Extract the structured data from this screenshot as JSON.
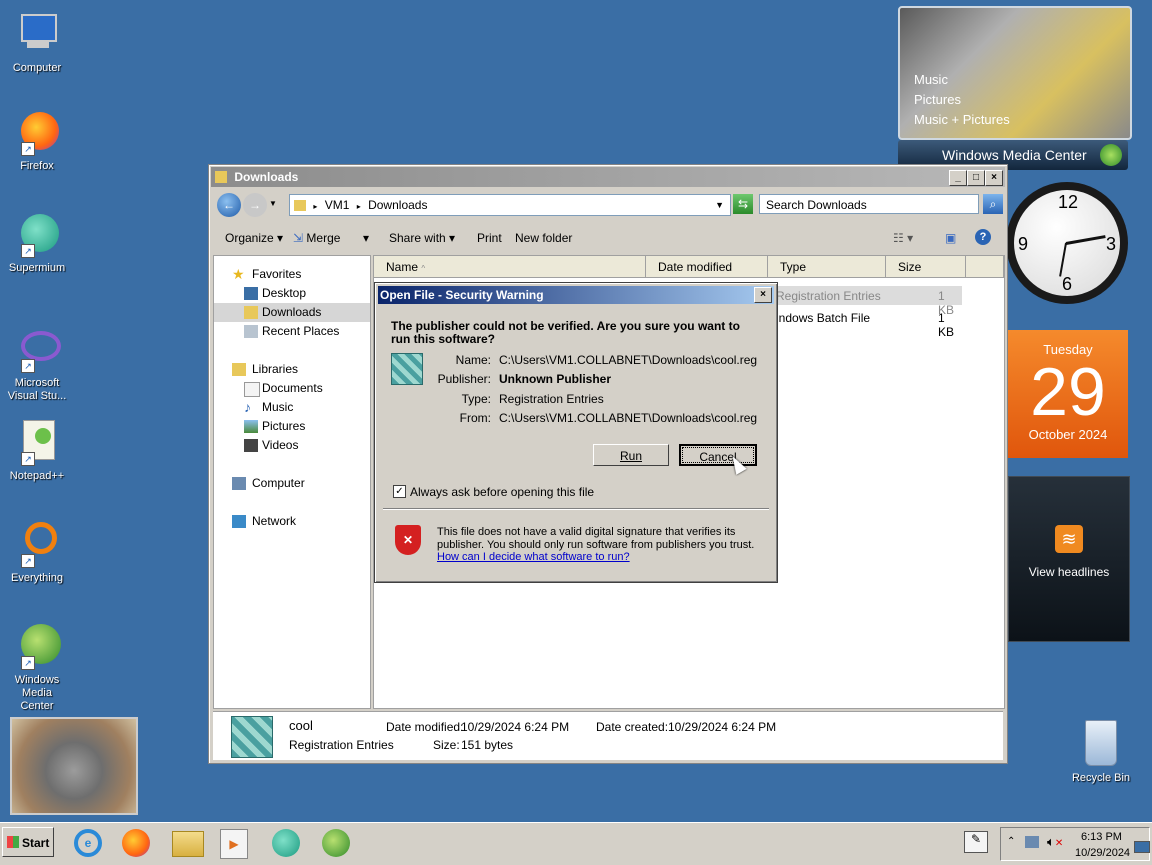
{
  "desktop": {
    "icons": [
      {
        "label": "Computer",
        "icon": "computer-icon"
      },
      {
        "label": "Firefox",
        "icon": "firefox-icon"
      },
      {
        "label": "Supermium",
        "icon": "supermium-icon"
      },
      {
        "label": "Microsoft Visual Stu...",
        "icon": "visual-studio-icon"
      },
      {
        "label": "Notepad++",
        "icon": "notepad-plus-plus-icon"
      },
      {
        "label": "Everything",
        "icon": "everything-icon"
      },
      {
        "label": "Windows Media Center",
        "icon": "windows-media-center-icon"
      }
    ],
    "recycle_bin": "Recycle Bin"
  },
  "gadgets": {
    "media_center": {
      "items": [
        "Music",
        "Pictures",
        "Music + Pictures"
      ],
      "brand": "Windows Media Center"
    },
    "calendar": {
      "weekday": "Tuesday",
      "day": "29",
      "month_year": "October 2024"
    },
    "feed": {
      "label": "View headlines"
    }
  },
  "explorer": {
    "title": "Downloads",
    "address": {
      "root": "VM1",
      "folder": "Downloads"
    },
    "search_placeholder": "Search Downloads",
    "toolbar": {
      "organize": "Organize",
      "merge": "Merge",
      "share_with": "Share with",
      "print": "Print",
      "new_folder": "New folder"
    },
    "nav": {
      "favorites": "Favorites",
      "favorites_items": [
        "Desktop",
        "Downloads",
        "Recent Places"
      ],
      "libraries": "Libraries",
      "libraries_items": [
        "Documents",
        "Music",
        "Pictures",
        "Videos"
      ],
      "computer": "Computer",
      "network": "Network"
    },
    "columns": {
      "name": "Name",
      "date_modified": "Date modified",
      "type": "Type",
      "size": "Size"
    },
    "rows": [
      {
        "type": "Registration Entries",
        "size": "1 KB"
      },
      {
        "type": "indows Batch File",
        "size": "1 KB"
      }
    ],
    "details": {
      "name": "cool",
      "type": "Registration Entries",
      "date_modified_label": "Date modified:",
      "date_modified": "10/29/2024 6:24 PM",
      "date_created_label": "Date created:",
      "date_created": "10/29/2024 6:24 PM",
      "size_label": "Size:",
      "size": "151 bytes"
    }
  },
  "dialog": {
    "title": "Open File - Security Warning",
    "question": "The publisher could not be verified.  Are you sure you want to run this software?",
    "fields": [
      {
        "label": "Name:",
        "value": "C:\\Users\\VM1.COLLABNET\\Downloads\\cool.reg"
      },
      {
        "label": "Publisher:",
        "value": "Unknown Publisher"
      },
      {
        "label": "Type:",
        "value": "Registration Entries"
      },
      {
        "label": "From:",
        "value": "C:\\Users\\VM1.COLLABNET\\Downloads\\cool.reg"
      }
    ],
    "run_label": "Run",
    "cancel_label": "Cancel",
    "checkbox_label": "Always ask before opening this file",
    "warning_text": "This file does not have a valid digital signature that verifies its publisher.  You should only run software from publishers you trust.",
    "link_text": "How can I decide what software to run?"
  },
  "taskbar": {
    "start": "Start",
    "time": "6:13 PM",
    "date": "10/29/2024"
  }
}
